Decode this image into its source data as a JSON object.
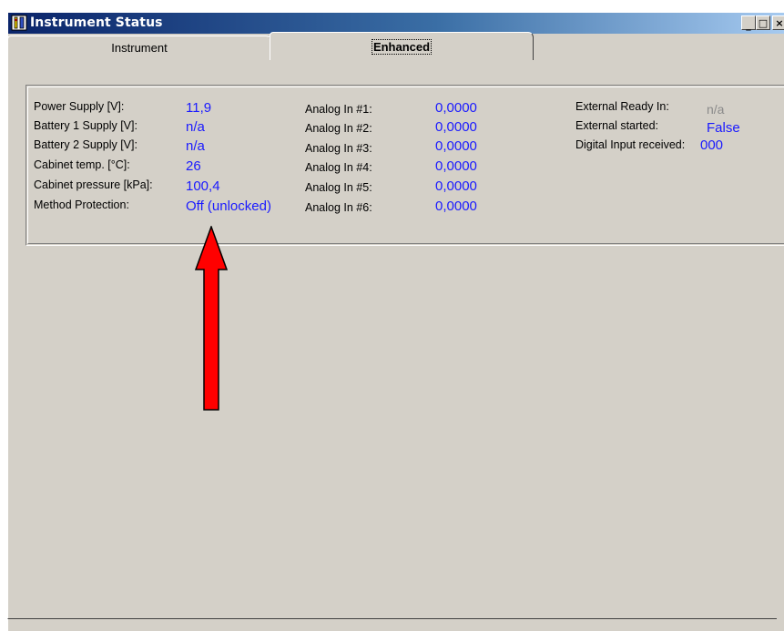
{
  "window": {
    "title": "Instrument Status",
    "minimize": "_",
    "maximize": "□",
    "close": "×"
  },
  "tabs": [
    {
      "label": "Instrument",
      "active": false
    },
    {
      "label": "Enhanced",
      "active": true
    }
  ],
  "status": {
    "col1": [
      {
        "label": "Power Supply [V]:",
        "value": "11,9"
      },
      {
        "label": "Battery 1 Supply [V]:",
        "value": "n/a"
      },
      {
        "label": "Battery 2 Supply [V]:",
        "value": "n/a"
      },
      {
        "label": "Cabinet temp. [°C]:",
        "value": "26"
      },
      {
        "label": "Cabinet pressure [kPa]:",
        "value": "100,4"
      },
      {
        "label": "Method Protection:",
        "value": "Off (unlocked)"
      }
    ],
    "col2": [
      {
        "label": "Analog In #1:",
        "value": "0,0000"
      },
      {
        "label": "Analog In #2:",
        "value": "0,0000"
      },
      {
        "label": "Analog In #3:",
        "value": "0,0000"
      },
      {
        "label": "Analog In #4:",
        "value": "0,0000"
      },
      {
        "label": "Analog In #5:",
        "value": "0,0000"
      },
      {
        "label": "Analog In #6:",
        "value": "0,0000"
      }
    ],
    "col3": [
      {
        "label": "External Ready In:",
        "value": "n/a"
      },
      {
        "label": "External started:",
        "value": "False"
      },
      {
        "label": "Digital Input received:",
        "value": "000"
      }
    ]
  },
  "colors": {
    "value_text": "#1a1aff",
    "disabled_value": "#8a8a8a",
    "arrow": "#ff0000",
    "titlebar": "#0a246a"
  },
  "icons": {
    "app": "instrument-app-icon",
    "arrow": "red-up-arrow-annotation"
  }
}
